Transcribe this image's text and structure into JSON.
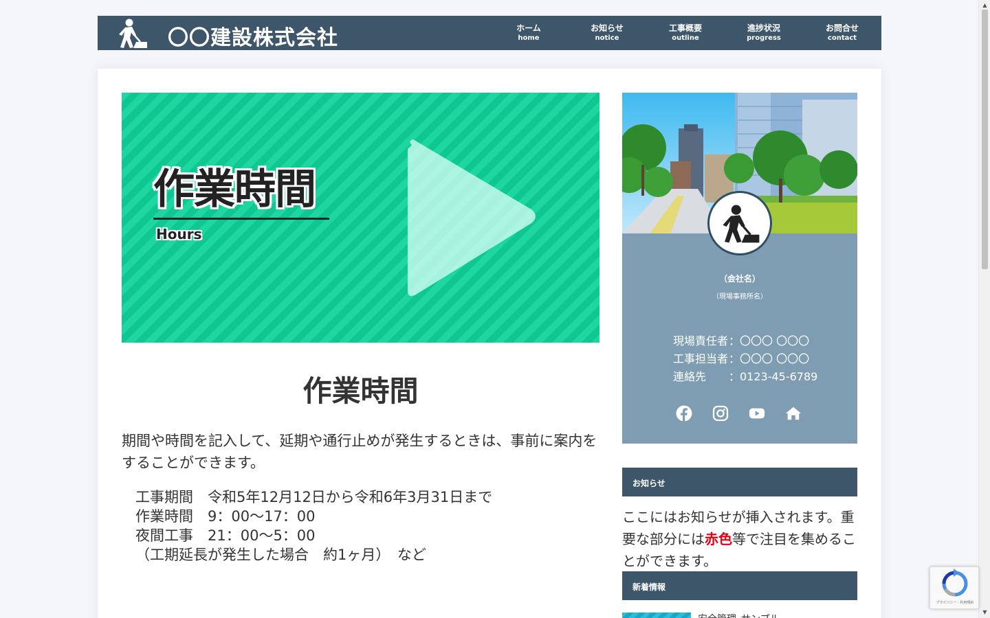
{
  "header": {
    "site_title": "〇〇建設株式会社",
    "logo_icon": "construction-worker-icon",
    "nav": [
      {
        "jp": "ホーム",
        "en": "home"
      },
      {
        "jp": "お知らせ",
        "en": "notice"
      },
      {
        "jp": "工事概要",
        "en": "outline"
      },
      {
        "jp": "進捗状況",
        "en": "progress"
      },
      {
        "jp": "お問合せ",
        "en": "contact"
      }
    ]
  },
  "eyecatch": {
    "title": "作業時間",
    "subtitle": "Hours",
    "icon": "play-icon"
  },
  "post": {
    "title": "作業時間",
    "intro": "期間や時間を記入して、延期や通行止めが発生するときは、事前に案内をすることができます。",
    "lines": [
      "工事期間　令和5年12月12日から令和6年3月31日まで",
      "作業時間　9：00～17：00",
      "夜間工事　21：00～5：00",
      "（工期延長が発生した場合　約1ヶ月）　など"
    ]
  },
  "profile": {
    "company": "（会社名）",
    "office": "（現場事務所名）",
    "contacts": [
      {
        "label": "現場責任者",
        "value": "：〇〇〇 〇〇〇"
      },
      {
        "label": "工事担当者",
        "value": "：〇〇〇 〇〇〇"
      },
      {
        "label": "連絡先",
        "value": "：0123-45-6789"
      }
    ],
    "socials": [
      "facebook-icon",
      "instagram-icon",
      "youtube-icon",
      "home-icon"
    ]
  },
  "sidebar": {
    "notice_heading": "お知らせ",
    "notice_text_before": "ここにはお知らせが挿入されます。重要な部分には",
    "notice_text_red": "赤色",
    "notice_text_after": "等で注目を集めることができます。",
    "news_heading": "新着情報",
    "news_item": "安全管理_サンプル"
  },
  "recaptcha": {
    "text": "プライバシー - 利用規約"
  },
  "colors": {
    "header": "#3d5669",
    "profile_bg": "#7f9db2",
    "eyecatch_green": "#1dd6a0",
    "accent_red": "#e60012"
  }
}
